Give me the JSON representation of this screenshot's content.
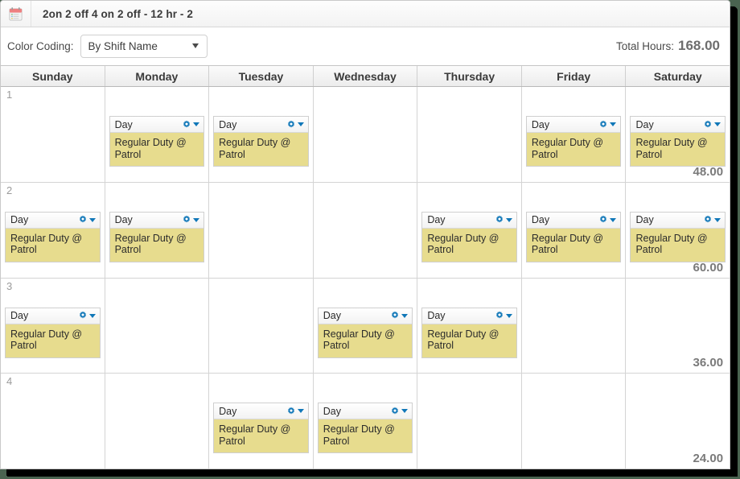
{
  "window": {
    "title": "2on 2 off 4 on 2 off - 12 hr - 2",
    "icon": "calendar-icon"
  },
  "toolbar": {
    "color_coding_label": "Color Coding:",
    "color_coding_value": "By Shift Name",
    "color_coding_options": [
      "By Shift Name"
    ],
    "total_hours_label": "Total Hours:",
    "total_hours_value": "168.00"
  },
  "calendar": {
    "day_headers": [
      "Sunday",
      "Monday",
      "Tuesday",
      "Wednesday",
      "Thursday",
      "Friday",
      "Saturday"
    ],
    "accent_color": "#1077b8",
    "shift_body_color": "#e7dc8e",
    "weeks": [
      {
        "number": "1",
        "total": "48.00",
        "days": [
          {
            "shift": null
          },
          {
            "shift": {
              "name": "Day",
              "detail": "Regular Duty @ Patrol"
            }
          },
          {
            "shift": {
              "name": "Day",
              "detail": "Regular Duty @ Patrol"
            }
          },
          {
            "shift": null
          },
          {
            "shift": null
          },
          {
            "shift": {
              "name": "Day",
              "detail": "Regular Duty @ Patrol"
            }
          },
          {
            "shift": {
              "name": "Day",
              "detail": "Regular Duty @ Patrol"
            }
          }
        ]
      },
      {
        "number": "2",
        "total": "60.00",
        "days": [
          {
            "shift": {
              "name": "Day",
              "detail": "Regular Duty @ Patrol"
            }
          },
          {
            "shift": {
              "name": "Day",
              "detail": "Regular Duty @ Patrol"
            }
          },
          {
            "shift": null
          },
          {
            "shift": null
          },
          {
            "shift": {
              "name": "Day",
              "detail": "Regular Duty @ Patrol"
            }
          },
          {
            "shift": {
              "name": "Day",
              "detail": "Regular Duty @ Patrol"
            }
          },
          {
            "shift": {
              "name": "Day",
              "detail": "Regular Duty @ Patrol"
            }
          }
        ]
      },
      {
        "number": "3",
        "total": "36.00",
        "days": [
          {
            "shift": {
              "name": "Day",
              "detail": "Regular Duty @ Patrol"
            }
          },
          {
            "shift": null
          },
          {
            "shift": null
          },
          {
            "shift": {
              "name": "Day",
              "detail": "Regular Duty @ Patrol"
            }
          },
          {
            "shift": {
              "name": "Day",
              "detail": "Regular Duty @ Patrol"
            }
          },
          {
            "shift": null
          },
          {
            "shift": null
          }
        ]
      },
      {
        "number": "4",
        "total": "24.00",
        "days": [
          {
            "shift": null
          },
          {
            "shift": null
          },
          {
            "shift": {
              "name": "Day",
              "detail": "Regular Duty @ Patrol"
            }
          },
          {
            "shift": {
              "name": "Day",
              "detail": "Regular Duty @ Patrol"
            }
          },
          {
            "shift": null
          },
          {
            "shift": null
          },
          {
            "shift": null
          }
        ]
      }
    ]
  }
}
